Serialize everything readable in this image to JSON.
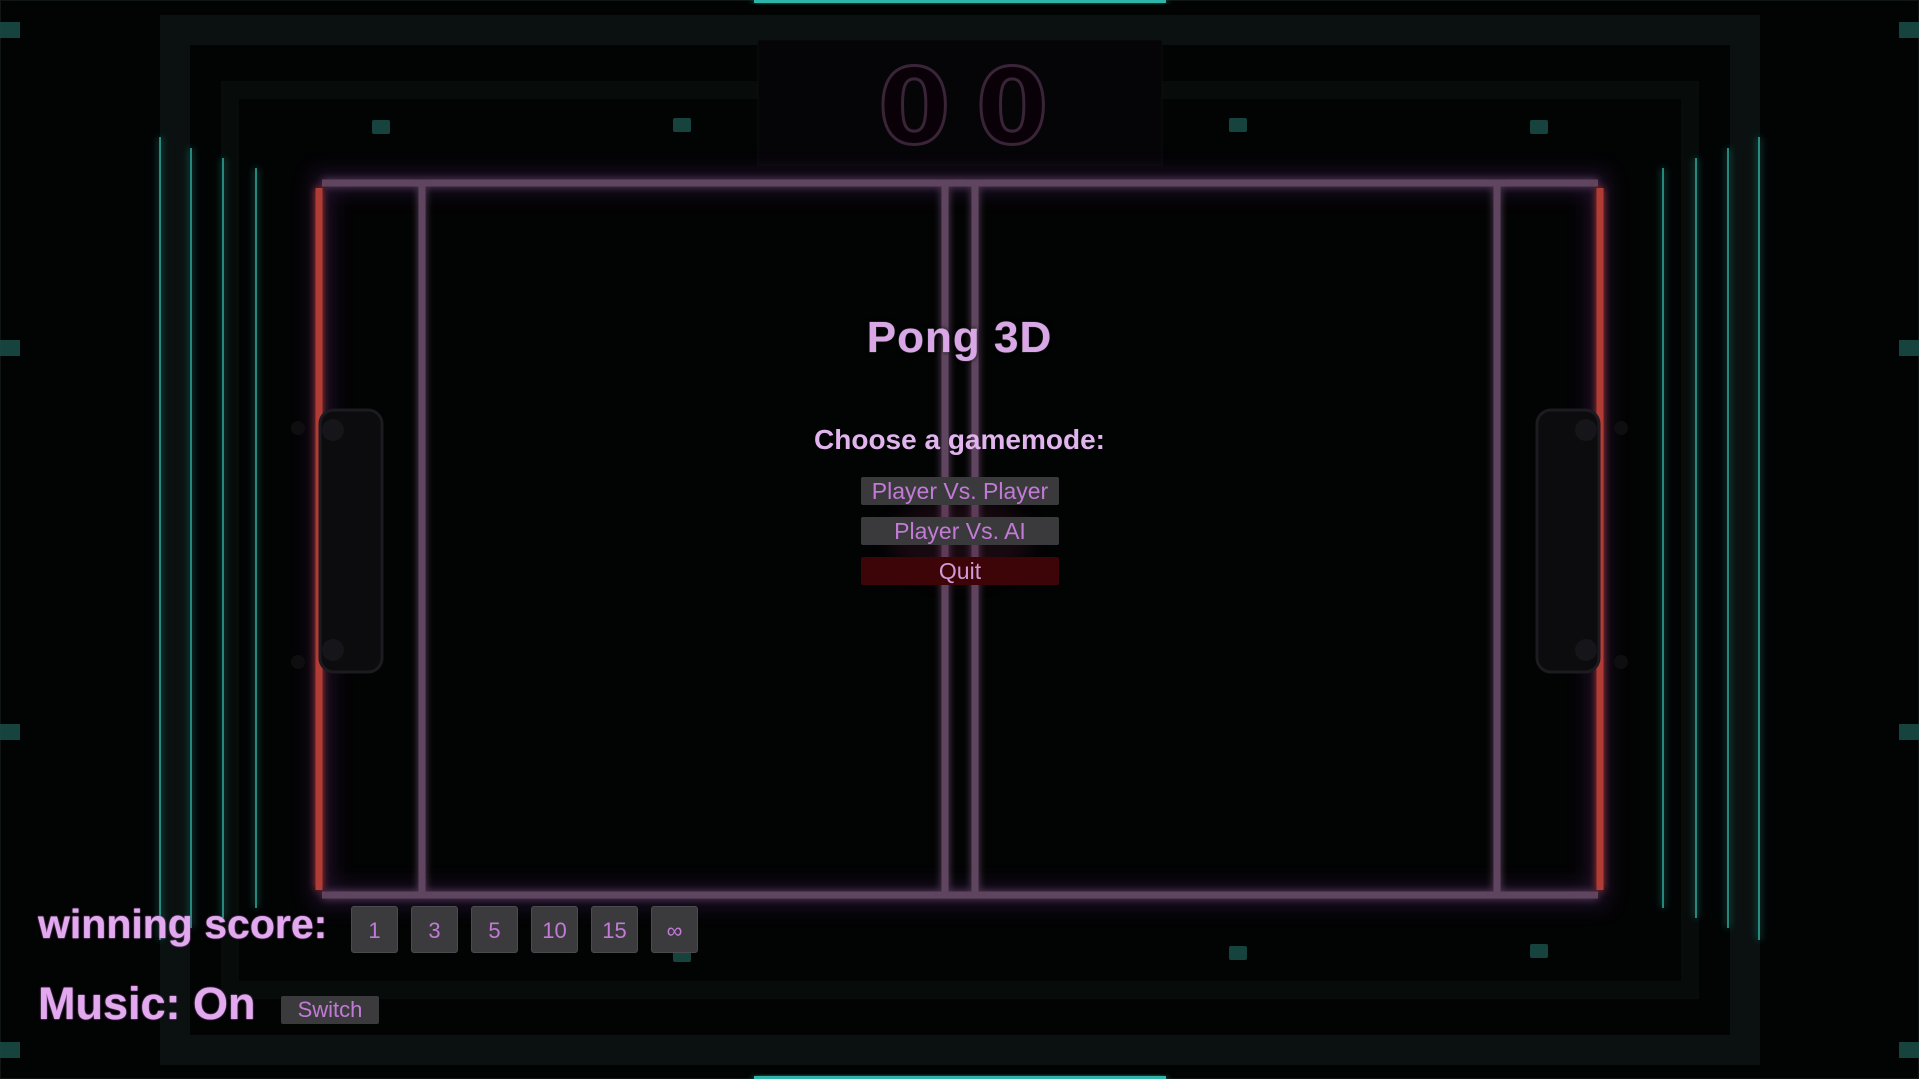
{
  "scoreboard": {
    "left_score": "0",
    "right_score": "0"
  },
  "menu": {
    "title": "Pong 3D",
    "subtitle": "Choose a gamemode:",
    "buttons": {
      "pvp": "Player Vs. Player",
      "pvai": "Player Vs. AI",
      "quit": "Quit"
    }
  },
  "winning_score": {
    "label": "winning score:",
    "options": [
      "1",
      "3",
      "5",
      "10",
      "15",
      "∞"
    ]
  },
  "music": {
    "label": "Music: On",
    "switch_label": "Switch"
  },
  "colors": {
    "neon_purple": "#7a5a82",
    "neon_red": "#c0392b",
    "neon_teal": "#2fb5a8",
    "text_pink": "#e3a9ef",
    "button_gray": "#3b3b3e",
    "quit_red": "#3d0508"
  }
}
